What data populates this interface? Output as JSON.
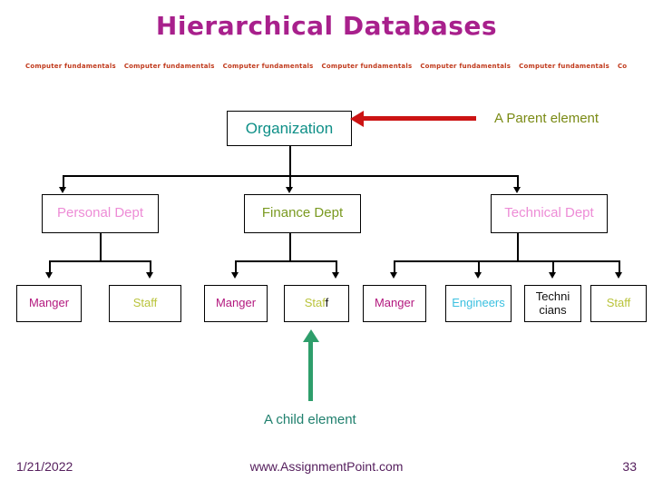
{
  "slide": {
    "title": "Hierarchical Databases",
    "title_color": "#A8208C",
    "background": "#ffffff"
  },
  "watermark": {
    "text": "Computer fundamentals",
    "repeat": 8,
    "color": "#C0391B"
  },
  "chart_data": {
    "type": "diagram",
    "diagram_kind": "hierarchy-tree",
    "title": "Hierarchical Databases",
    "levels": 3,
    "nodes": [
      {
        "id": "organization",
        "label": "Organization",
        "level": 0,
        "parent": null,
        "color": "#0E8F87"
      },
      {
        "id": "personal-dept",
        "label": "Personal Dept",
        "level": 1,
        "parent": "organization",
        "color": "#ED8CD6"
      },
      {
        "id": "finance-dept",
        "label": "Finance Dept",
        "level": 1,
        "parent": "organization",
        "color": "#7A9A21"
      },
      {
        "id": "technical-dept",
        "label": "Technical Dept",
        "level": 1,
        "parent": "organization",
        "color": "#ED8CD6"
      },
      {
        "id": "manger-1",
        "label": "Manger",
        "level": 2,
        "parent": "personal-dept",
        "color": "#B3187E"
      },
      {
        "id": "staff-1",
        "label": "Staff",
        "level": 2,
        "parent": "personal-dept",
        "color": "#B9C33A"
      },
      {
        "id": "manger-2",
        "label": "Manger",
        "level": 2,
        "parent": "finance-dept",
        "color": "#B3187E"
      },
      {
        "id": "staff-2",
        "label": "Staff",
        "level": 2,
        "parent": "finance-dept",
        "color": "#B9C33A"
      },
      {
        "id": "manger-3",
        "label": "Manger",
        "level": 2,
        "parent": "technical-dept",
        "color": "#B3187E"
      },
      {
        "id": "engineers",
        "label": "Engineers",
        "level": 2,
        "parent": "technical-dept",
        "color": "#3BC0E0"
      },
      {
        "id": "technicians",
        "label": "Techni cians",
        "level": 2,
        "parent": "technical-dept",
        "color": "#111111"
      },
      {
        "id": "staff-3",
        "label": "Staff",
        "level": 2,
        "parent": "technical-dept",
        "color": "#B9C33A"
      }
    ]
  },
  "nodes": {
    "organization": "Organization",
    "personal_dept": "Personal Dept",
    "finance_dept": "Finance Dept",
    "technical_dept": "Technical Dept",
    "manger_1": "Manger",
    "staff_1": "Staff",
    "manger_2": "Manger",
    "staff_2_main": "Staf",
    "staff_2_tail": "f",
    "manger_3": "Manger",
    "engineers": "Engineers",
    "technicians_line1": "Techni",
    "technicians_line2": "cians",
    "staff_3": "Staff"
  },
  "annotations": {
    "parent_label": "A Parent element",
    "parent_label_color": "#7A8A14",
    "parent_arrow_color": "#CC1414",
    "child_label": "A child element",
    "child_label_color": "#20806E",
    "child_arrow_color": "#2E9E6B"
  },
  "footer": {
    "date": "1/21/2022",
    "site": "www.AssignmentPoint.com",
    "page": "33",
    "color": "#56205E"
  }
}
